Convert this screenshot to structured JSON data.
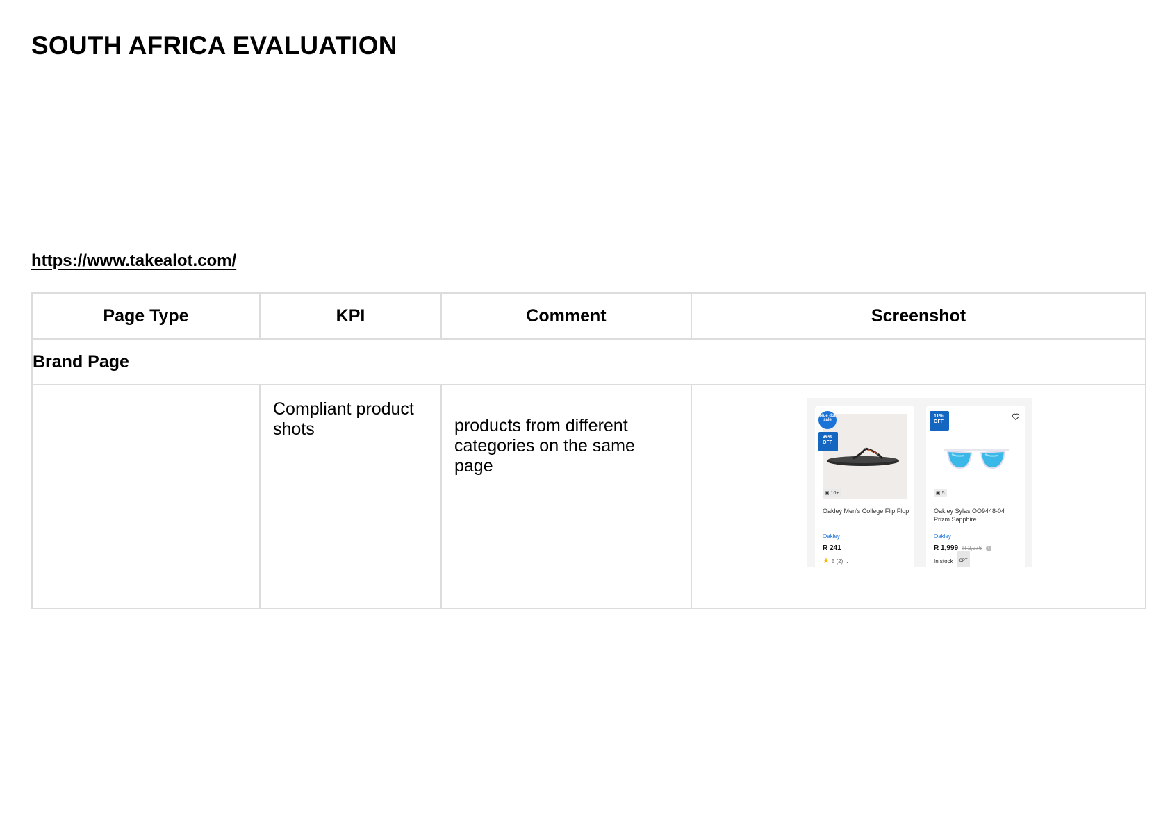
{
  "title": "SOUTH AFRICA EVALUATION",
  "url": "https://www.takealot.com/",
  "table": {
    "headers": [
      "Page Type",
      "KPI",
      "Comment",
      "Screenshot"
    ],
    "section": "Brand Page",
    "rows": [
      {
        "page_type": "",
        "kpi": "Compliant product shots",
        "comment": "products from different categories on the same page"
      }
    ]
  },
  "screenshot": {
    "products": [
      {
        "badge_circle": "blue dot sale",
        "discount": "36% OFF",
        "photo_count": "10+",
        "name": "Oakley Men's College Flip Flop",
        "brand": "Oakley",
        "price": "R 241",
        "rating": "5 (2)",
        "icons": [
          "camera-icon",
          "star-icon",
          "chevron-down-icon"
        ]
      },
      {
        "discount": "11% OFF",
        "photo_count": "5",
        "name": "Oakley Sylas OO9448-04 Prizm Sapphire",
        "brand": "Oakley",
        "price": "R 1,999",
        "old_price": "R 2,276",
        "stock": "In stock",
        "location_tag": "CPT",
        "icons": [
          "heart-icon",
          "camera-icon",
          "info-icon"
        ]
      }
    ],
    "colors": {
      "accent": "#1b73d8",
      "star": "#f5b400",
      "lens": "#3ab8e8"
    }
  }
}
